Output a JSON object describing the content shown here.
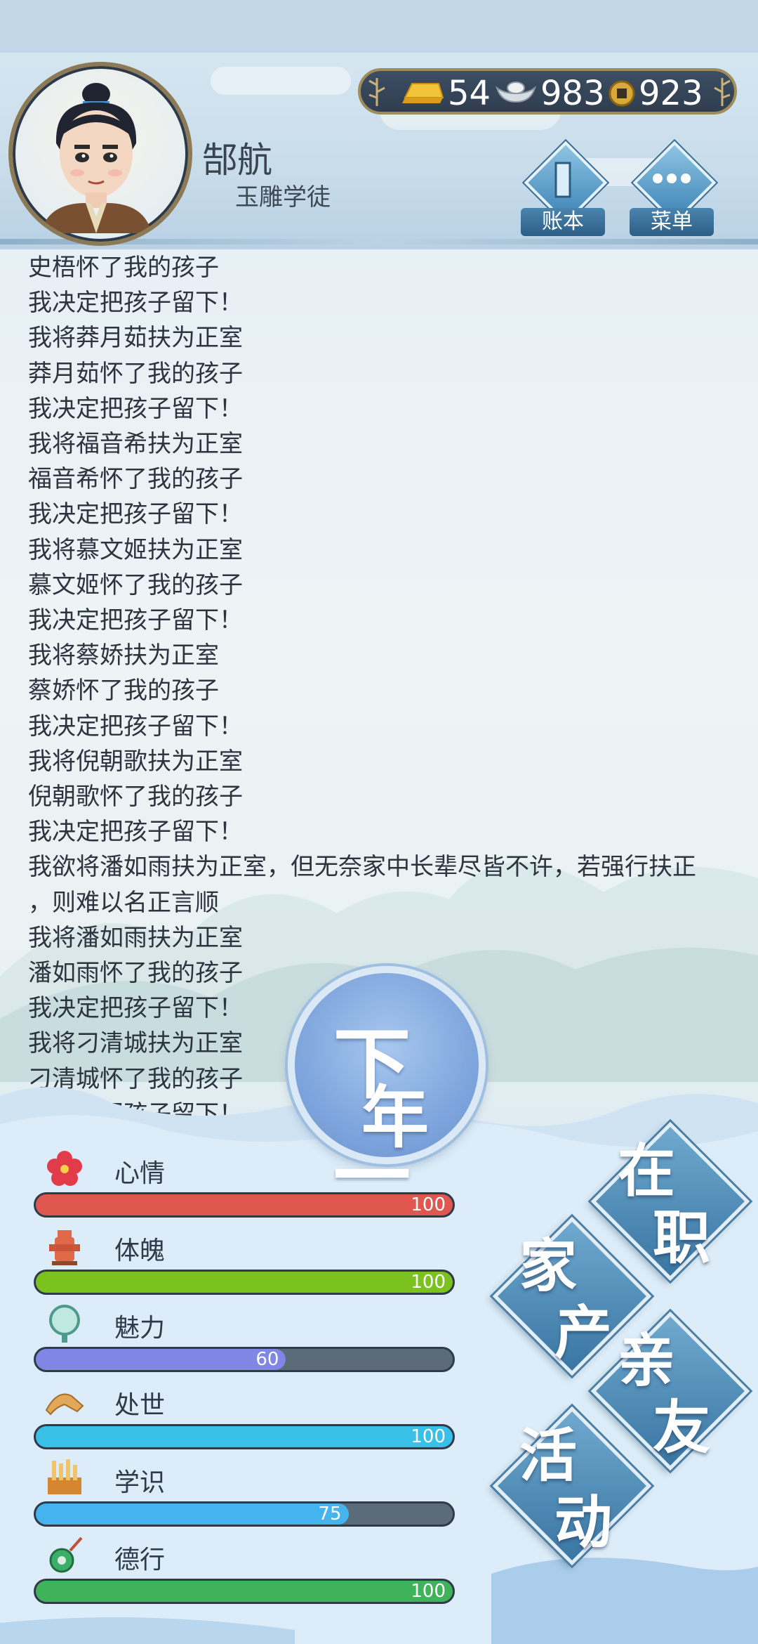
{
  "player": {
    "name": "郜航",
    "rank": "玉雕学徒"
  },
  "currency": {
    "gold": "54",
    "silver": "983",
    "coin": "923"
  },
  "menu": {
    "ledger_label": "账本",
    "menu_label": "菜单"
  },
  "log": [
    "史梧怀了我的孩子",
    "我决定把孩子留下！",
    "我将莽月茹扶为正室",
    "莽月茹怀了我的孩子",
    "我决定把孩子留下！",
    "我将福音希扶为正室",
    "福音希怀了我的孩子",
    "我决定把孩子留下！",
    "我将慕文姬扶为正室",
    "慕文姬怀了我的孩子",
    "我决定把孩子留下！",
    "我将蔡娇扶为正室",
    "蔡娇怀了我的孩子",
    "我决定把孩子留下！",
    "我将倪朝歌扶为正室",
    "倪朝歌怀了我的孩子",
    "我决定把孩子留下！",
    "我欲将潘如雨扶为正室，但无奈家中长辈尽皆不许，若强行扶正",
    "，则难以名正言顺",
    "我将潘如雨扶为正室",
    "潘如雨怀了我的孩子",
    "我决定把孩子留下！",
    "我将刁清城扶为正室",
    "刁清城怀了我的孩子",
    "我决定把孩子留下！"
  ],
  "next_year": {
    "line1": "下一",
    "line2": "年"
  },
  "stats": [
    {
      "label": "心情",
      "value": 100,
      "max": 100,
      "color": "#e0574f",
      "icon": "flower-icon"
    },
    {
      "label": "体魄",
      "value": 100,
      "max": 100,
      "color": "#7cc21e",
      "icon": "hydrant-icon"
    },
    {
      "label": "魅力",
      "value": 60,
      "max": 100,
      "color": "#7f86e6",
      "icon": "mirror-icon"
    },
    {
      "label": "处世",
      "value": 100,
      "max": 100,
      "color": "#38c0e8",
      "icon": "hands-icon"
    },
    {
      "label": "学识",
      "value": 75,
      "max": 100,
      "color": "#45b4ee",
      "icon": "books-icon"
    },
    {
      "label": "德行",
      "value": 100,
      "max": 100,
      "color": "#3fb35a",
      "icon": "jade-icon"
    }
  ],
  "actions": {
    "job": [
      "在",
      "职"
    ],
    "property": [
      "家",
      "产"
    ],
    "friends": [
      "亲",
      "友"
    ],
    "activity": [
      "活",
      "动"
    ]
  }
}
